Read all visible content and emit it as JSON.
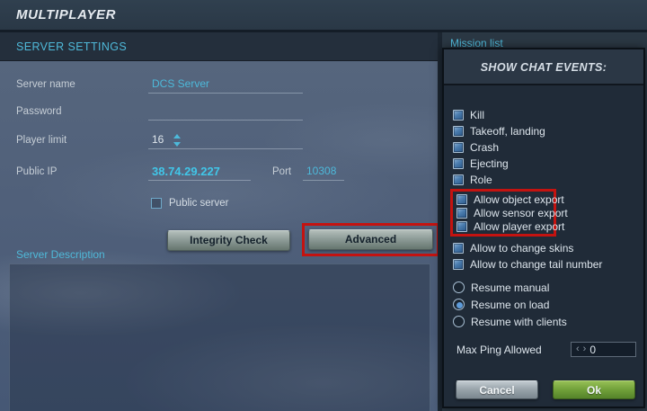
{
  "header": {
    "title": "MULTIPLAYER"
  },
  "server_settings": {
    "section_title": "SERVER SETTINGS",
    "server_name_label": "Server name",
    "server_name_value": "DCS Server",
    "password_label": "Password",
    "password_value": "",
    "player_limit_label": "Player limit",
    "player_limit_value": "16",
    "public_ip_label": "Public IP",
    "public_ip_value": "38.74.29.227",
    "port_label": "Port",
    "port_value": "10308",
    "public_server_label": "Public server",
    "public_server_checked": false,
    "integrity_check_button": "Integrity Check",
    "advanced_button": "Advanced",
    "description_label": "Server Description",
    "description_value": ""
  },
  "chat_events": {
    "mission_list_label": "Mission list",
    "panel_title": "SHOW CHAT EVENTS:",
    "checkboxes": [
      {
        "label": "Kill",
        "checked": true
      },
      {
        "label": "Takeoff, landing",
        "checked": true
      },
      {
        "label": "Crash",
        "checked": true
      },
      {
        "label": "Ejecting",
        "checked": true
      },
      {
        "label": "Role",
        "checked": true
      },
      {
        "label": "Allow object export",
        "checked": true,
        "highlighted": true
      },
      {
        "label": "Allow sensor export",
        "checked": true,
        "highlighted": true
      },
      {
        "label": "Allow player export",
        "checked": true,
        "highlighted": true
      },
      {
        "label": "Allow to change skins",
        "checked": true
      },
      {
        "label": "Allow to change tail number",
        "checked": true
      }
    ],
    "radios": [
      {
        "label": "Resume manual",
        "selected": false
      },
      {
        "label": "Resume on load",
        "selected": true
      },
      {
        "label": "Resume with clients",
        "selected": false
      }
    ],
    "max_ping_label": "Max Ping Allowed",
    "max_ping_value": "0",
    "cancel_button": "Cancel",
    "ok_button": "Ok"
  },
  "colors": {
    "accent_cyan": "#4db9da",
    "highlight_red": "#c41310",
    "ok_green": "#71a13a",
    "panel_bg": "#202b38"
  }
}
